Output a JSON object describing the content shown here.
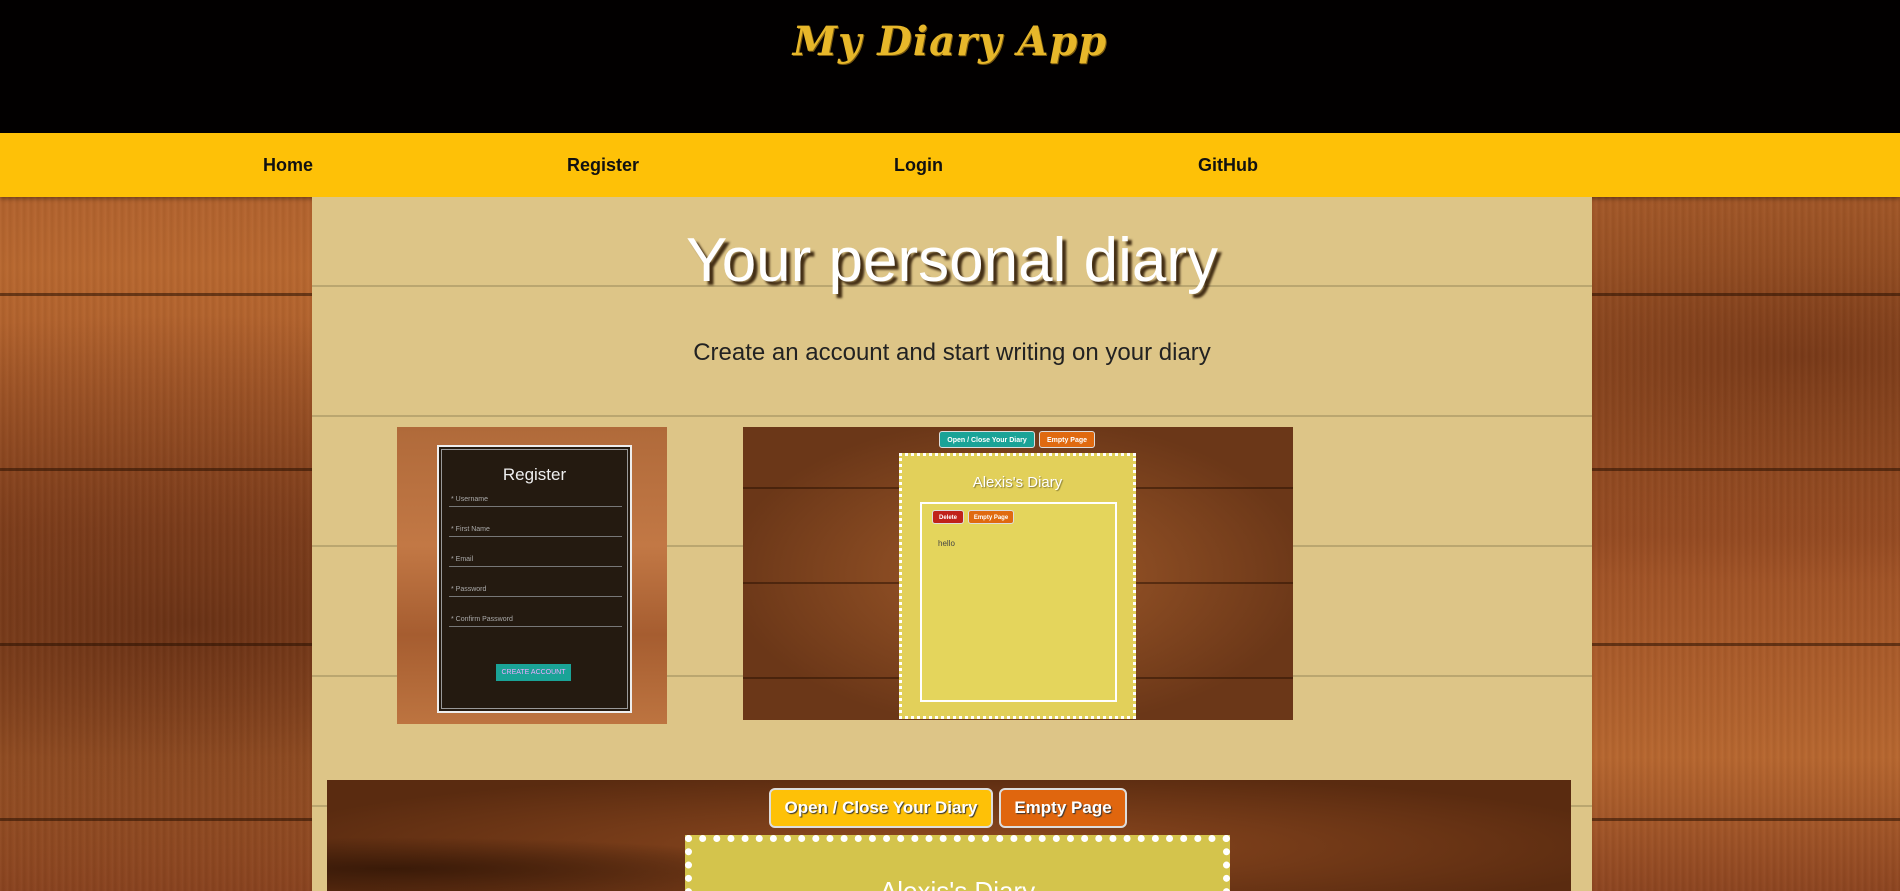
{
  "header": {
    "logo": "My Diary App"
  },
  "nav": {
    "items": [
      {
        "label": "Home"
      },
      {
        "label": "Register"
      },
      {
        "label": "Login"
      },
      {
        "label": "GitHub"
      }
    ]
  },
  "hero": {
    "title": "Your personal diary",
    "subtitle": "Create an account and start writing on your diary"
  },
  "register_preview": {
    "title": "Register",
    "fields": [
      "* Username",
      "* First Name",
      "* Email",
      "* Password",
      "* Confirm Password"
    ],
    "button": "CREATE ACCOUNT"
  },
  "diary_preview": {
    "open_close_button": "Open / Close Your Diary",
    "empty_page_button": "Empty Page",
    "diary_name": "Alexis's Diary",
    "delete_button": "Delete",
    "page_empty_button": "Empty Page",
    "entry_text": "hello"
  },
  "big_preview": {
    "open_close_button": "Open / Close Your Diary",
    "empty_page_button": "Empty Page",
    "diary_name": "Alexis's Diary"
  },
  "colors": {
    "nav_bg": "#fec107",
    "header_bg": "#020000",
    "logo": "#e7b72a",
    "panel_bg": "#ddc587"
  }
}
